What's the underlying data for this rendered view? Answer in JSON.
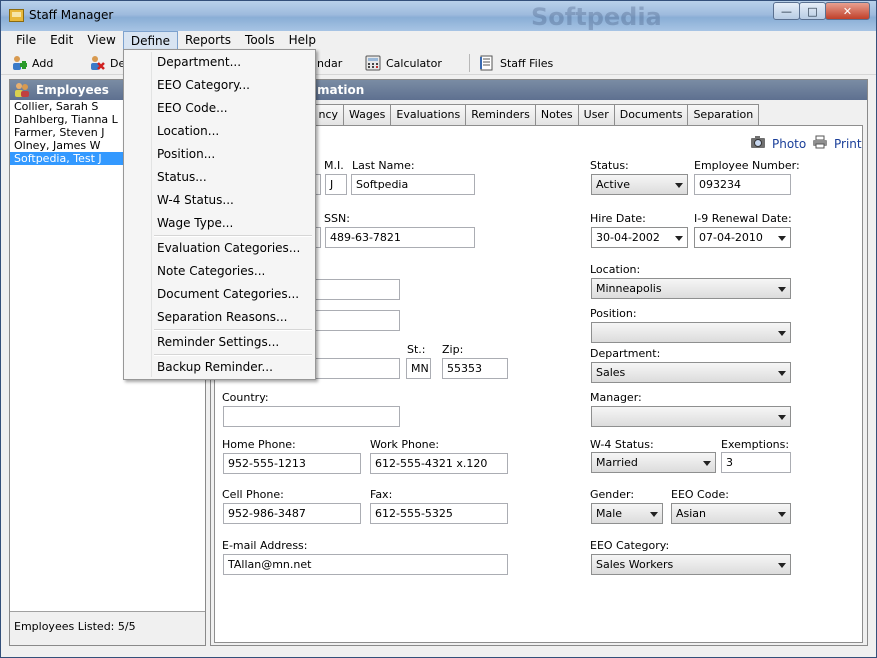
{
  "window": {
    "title": "Staff Manager",
    "watermark": "Softpedia"
  },
  "menubar": {
    "items": [
      "File",
      "Edit",
      "View",
      "Define",
      "Reports",
      "Tools",
      "Help"
    ]
  },
  "toolbar": {
    "add": "Add",
    "delete": "De",
    "calendar": "ndar",
    "calculator": "Calculator",
    "staff_files": "Staff Files"
  },
  "employees": {
    "header": "Employees",
    "list": [
      "Collier, Sarah S",
      "Dahlberg, Tianna L",
      "Farmer, Steven J",
      "Olney, James W",
      "Softpedia, Test J"
    ],
    "selected_index": 4,
    "footer": "Employees Listed: 5/5"
  },
  "detail": {
    "header": "mation",
    "tabs": [
      "ncy",
      "Wages",
      "Evaluations",
      "Reminders",
      "Notes",
      "User",
      "Documents",
      "Separation"
    ],
    "photo": "Photo",
    "print": "Print",
    "mi_label": "M.I.",
    "mi": "J",
    "last_name_label": "Last Name:",
    "last_name": "Softpedia",
    "ssn_label": "SSN:",
    "ssn": "489-63-7821",
    "st_label": "St.:",
    "st": "MN",
    "zip_label": "Zip:",
    "zip": "55353",
    "country_label": "Country:",
    "country": "",
    "home_phone_label": "Home Phone:",
    "home_phone": "952-555-1213",
    "work_phone_label": "Work Phone:",
    "work_phone": "612-555-4321 x.120",
    "cell_phone_label": "Cell Phone:",
    "cell_phone": "952-986-3487",
    "fax_label": "Fax:",
    "fax": "612-555-5325",
    "email_label": "E-mail Address:",
    "email": "TAllan@mn.net",
    "status_label": "Status:",
    "status": "Active",
    "emp_number_label": "Employee Number:",
    "emp_number": "093234",
    "hire_date_label": "Hire Date:",
    "hire_date": "30-04-2002",
    "i9_label": "I-9 Renewal Date:",
    "i9": "07-04-2010",
    "location_label": "Location:",
    "location": "Minneapolis",
    "position_label": "Position:",
    "position": "",
    "department_label": "Department:",
    "department": "Sales",
    "manager_label": "Manager:",
    "manager": "",
    "w4_label": "W-4 Status:",
    "w4": "Married",
    "exemptions_label": "Exemptions:",
    "exemptions": "3",
    "gender_label": "Gender:",
    "gender": "Male",
    "eeo_code_label": "EEO Code:",
    "eeo_code": "Asian",
    "eeo_category_label": "EEO Category:",
    "eeo_category": "Sales Workers"
  },
  "define_menu": {
    "items": [
      "Department...",
      "EEO Category...",
      "EEO Code...",
      "Location...",
      "Position...",
      "Status...",
      "W-4 Status...",
      "Wage Type...",
      "Evaluation Categories...",
      "Note Categories...",
      "Document Categories...",
      "Separation Reasons...",
      "Reminder Settings...",
      "Backup Reminder..."
    ]
  }
}
